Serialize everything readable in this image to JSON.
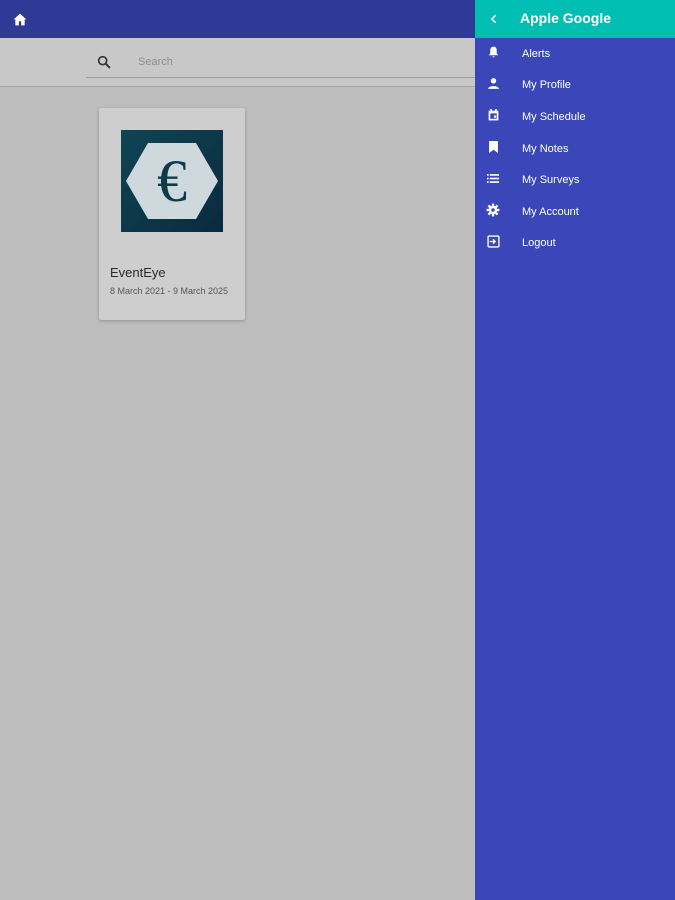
{
  "search": {
    "placeholder": "Search"
  },
  "event": {
    "name": "EventEye",
    "dates": "8 March 2021 - 9 March 2025",
    "logo_letter": "€"
  },
  "drawer": {
    "title": "Apple Google",
    "items": [
      {
        "label": "Alerts",
        "icon": "bell-icon"
      },
      {
        "label": "My Profile",
        "icon": "person-icon"
      },
      {
        "label": "My Schedule",
        "icon": "calendar-icon"
      },
      {
        "label": "My Notes",
        "icon": "bookmark-icon"
      },
      {
        "label": "My Surveys",
        "icon": "list-icon"
      },
      {
        "label": "My Account",
        "icon": "gear-icon"
      },
      {
        "label": "Logout",
        "icon": "logout-icon"
      }
    ]
  },
  "colors": {
    "appbar": "#2f3996",
    "drawer": "#3b47b9",
    "drawer_header": "#00bfb2",
    "background": "#bdbdbd"
  }
}
